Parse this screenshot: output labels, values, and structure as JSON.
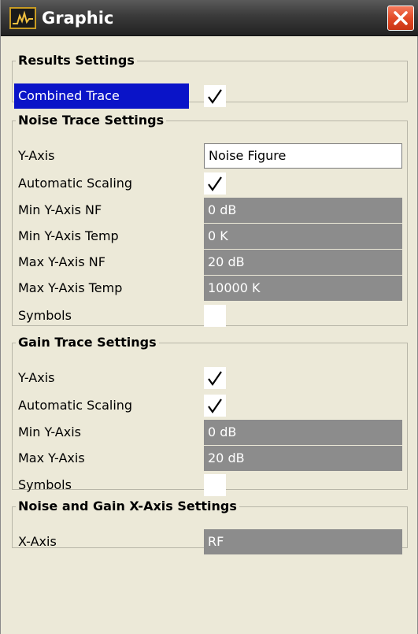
{
  "window": {
    "title": "Graphic",
    "icon": "trace-graph-icon",
    "close_icon": "close-icon"
  },
  "results": {
    "legend": "Results Settings",
    "combined_trace_label": "Combined Trace",
    "combined_trace_checked": true
  },
  "noise": {
    "legend": "Noise Trace Settings",
    "y_axis_label": "Y-Axis",
    "y_axis_value": "Noise Figure",
    "auto_scaling_label": "Automatic Scaling",
    "auto_scaling_checked": true,
    "min_nf_label": "Min Y-Axis NF",
    "min_nf_value": "0 dB",
    "min_temp_label": "Min Y-Axis Temp",
    "min_temp_value": "0 K",
    "max_nf_label": "Max Y-Axis NF",
    "max_nf_value": "20 dB",
    "max_temp_label": "Max Y-Axis Temp",
    "max_temp_value": "10000 K",
    "symbols_label": "Symbols",
    "symbols_checked": false
  },
  "gain": {
    "legend": "Gain Trace Settings",
    "y_axis_label": "Y-Axis",
    "y_axis_checked": true,
    "auto_scaling_label": "Automatic Scaling",
    "auto_scaling_checked": true,
    "min_label": "Min Y-Axis",
    "min_value": "0 dB",
    "max_label": "Max Y-Axis",
    "max_value": "20 dB",
    "symbols_label": "Symbols",
    "symbols_checked": false
  },
  "xaxis": {
    "legend": "Noise and Gain X-Axis Settings",
    "x_axis_label": "X-Axis",
    "x_axis_value": "RF"
  }
}
